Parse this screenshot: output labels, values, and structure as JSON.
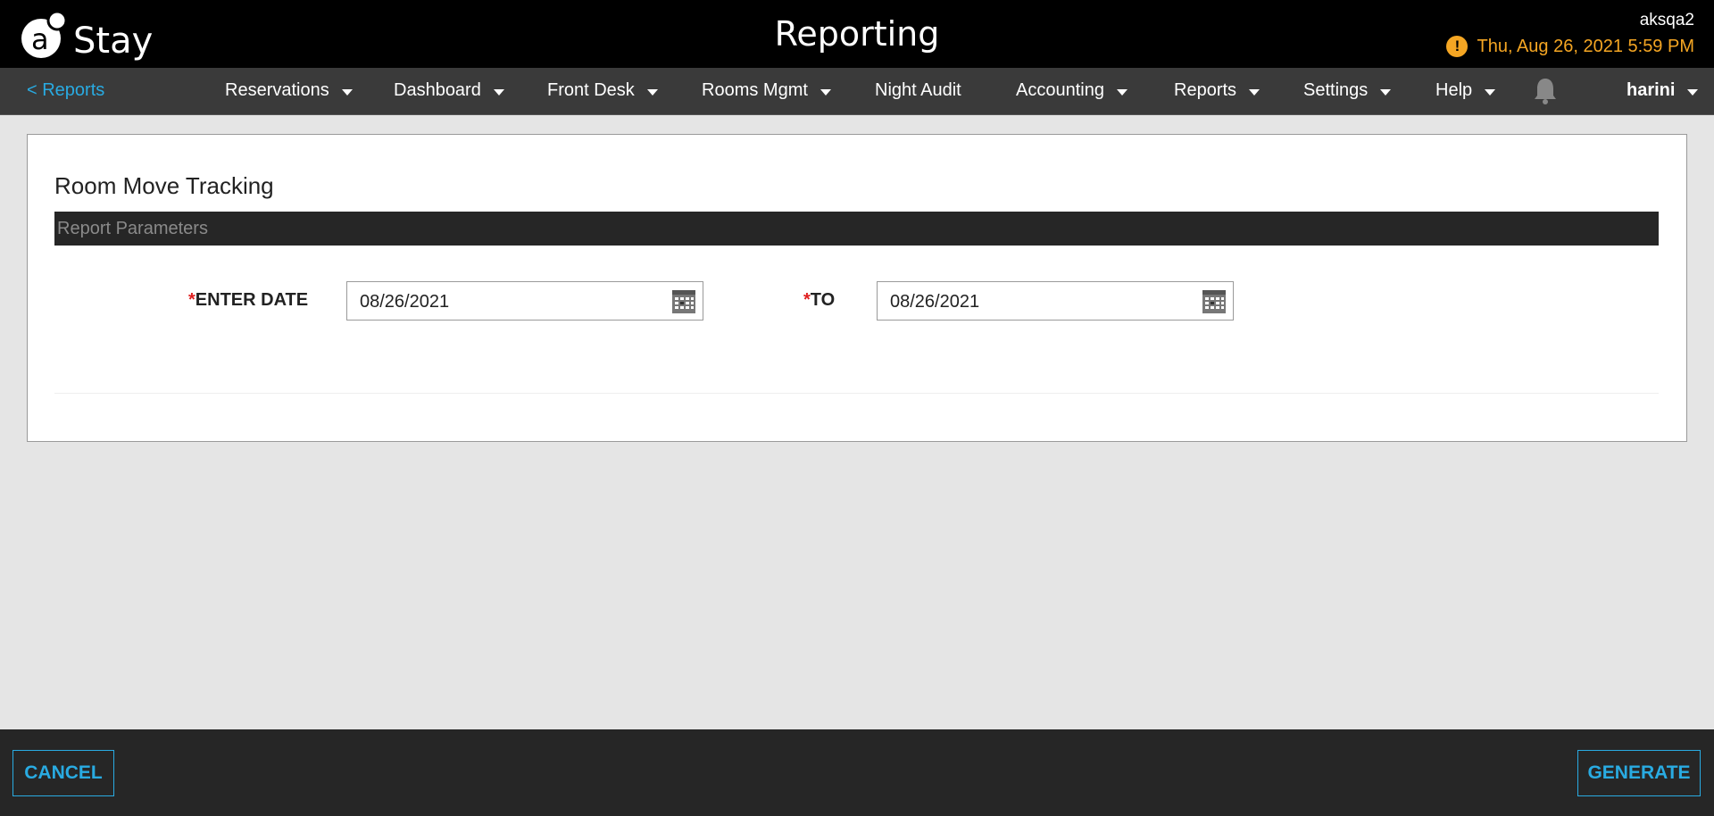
{
  "header": {
    "logo_text": "Stay",
    "title": "Reporting",
    "company": "aksqa2",
    "datetime": "Thu, Aug 26, 2021 5:59 PM",
    "warning_glyph": "!",
    "accent_color": "#f5a623"
  },
  "nav": {
    "back_label": "< Reports",
    "items": [
      {
        "label": "Reservations",
        "has_dropdown": true
      },
      {
        "label": "Dashboard",
        "has_dropdown": true
      },
      {
        "label": "Front Desk",
        "has_dropdown": true
      },
      {
        "label": "Rooms Mgmt",
        "has_dropdown": true
      },
      {
        "label": "Night Audit",
        "has_dropdown": false
      },
      {
        "label": "Accounting",
        "has_dropdown": true
      },
      {
        "label": "Reports",
        "has_dropdown": true
      },
      {
        "label": "Settings",
        "has_dropdown": true
      },
      {
        "label": "Help",
        "has_dropdown": true
      }
    ],
    "notification_icon": "bell-icon",
    "user": "harini",
    "link_color": "#29abe2"
  },
  "report": {
    "title": "Room Move Tracking",
    "parameters_heading": "Report Parameters",
    "required_marker": "*",
    "from_label": "ENTER DATE",
    "from_value": "08/26/2021",
    "to_label": "TO",
    "to_value": "08/26/2021",
    "calendar_icon": "calendar-icon"
  },
  "footer": {
    "cancel_label": "CANCEL",
    "generate_label": "GENERATE",
    "button_color": "#29abe2"
  }
}
